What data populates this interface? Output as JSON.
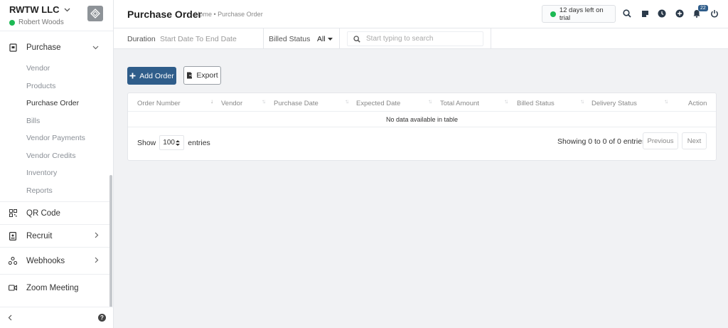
{
  "sidebar": {
    "org_name": "RWTW LLC",
    "user_name": "Robert Woods",
    "status_color": "#1db954",
    "purchase": {
      "label": "Purchase",
      "sub_items": [
        {
          "label": "Vendor"
        },
        {
          "label": "Products"
        },
        {
          "label": "Purchase Order",
          "active": true
        },
        {
          "label": "Bills"
        },
        {
          "label": "Vendor Payments"
        },
        {
          "label": "Vendor Credits"
        },
        {
          "label": "Inventory"
        },
        {
          "label": "Reports"
        }
      ]
    },
    "items": [
      {
        "label": "QR Code",
        "icon": "qr-code-icon"
      },
      {
        "label": "Recruit",
        "icon": "badge-icon"
      },
      {
        "label": "Webhooks",
        "icon": "webhooks-icon"
      },
      {
        "label": "Zoom Meeting",
        "icon": "video-icon"
      }
    ],
    "help_icon": "?"
  },
  "header": {
    "title": "Purchase Order",
    "breadcrumb": "Home • Purchase Order",
    "trial_text": "12 days left on trial",
    "notifications_count": "22",
    "accent_color": "#2f5d8a"
  },
  "filters": {
    "duration_label": "Duration",
    "duration_value": "Start Date To End Date",
    "billed_status_label": "Billed Status",
    "billed_status_value": "All",
    "search_placeholder": "Start typing to search"
  },
  "toolbar": {
    "add_label": "Add Order",
    "export_label": "Export"
  },
  "table": {
    "columns": [
      "Order Number",
      "Vendor",
      "Purchase Date",
      "Expected Date",
      "Total Amount",
      "Billed Status",
      "Delivery Status",
      "Action"
    ],
    "empty_text": "No data available in table",
    "show_label": "Show",
    "page_size": "100",
    "entries_label": "entries",
    "info": "Showing 0 to 0 of 0 entries",
    "previous_label": "Previous",
    "next_label": "Next"
  }
}
